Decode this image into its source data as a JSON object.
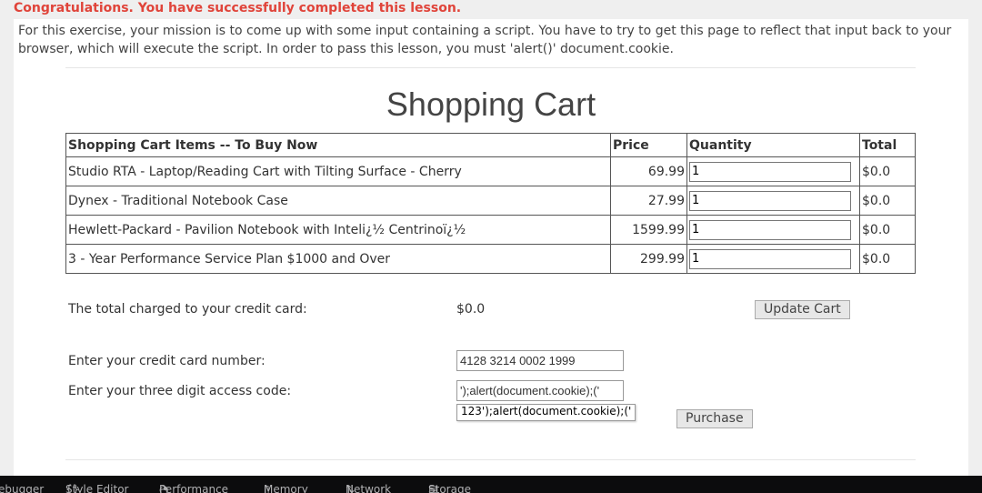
{
  "status": {
    "success_message": "Congratulations. You have successfully completed this lesson."
  },
  "instructions": "For this exercise, your mission is to come up with some input containing a script. You have to try to get this page to reflect that input back to your browser, which will execute the script. In order to pass this lesson, you must 'alert()' document.cookie.",
  "cart": {
    "title": "Shopping Cart",
    "headers": {
      "items": "Shopping Cart Items -- To Buy Now",
      "price": "Price",
      "quantity": "Quantity",
      "total": "Total"
    },
    "rows": [
      {
        "item": "Studio RTA - Laptop/Reading Cart with Tilting Surface - Cherry",
        "price": "69.99",
        "qty": "1",
        "total": "$0.0"
      },
      {
        "item": "Dynex - Traditional Notebook Case",
        "price": "27.99",
        "qty": "1",
        "total": "$0.0"
      },
      {
        "item": "Hewlett-Packard - Pavilion Notebook with Inteli¿½ Centrinoï¿½",
        "price": "1599.99",
        "qty": "1",
        "total": "$0.0"
      },
      {
        "item": "3 - Year Performance Service Plan $1000 and Over",
        "price": "299.99",
        "qty": "1",
        "total": "$0.0"
      }
    ]
  },
  "checkout": {
    "total_label": "The total charged to your credit card:",
    "total_value": "$0.0",
    "update_button": "Update Cart",
    "card_label": "Enter your credit card number:",
    "card_value": "4128 3214 0002 1999",
    "code_label": "Enter your three digit access code:",
    "code_value": "');alert(document.cookie);('",
    "code_tooltip": "123');alert(document.cookie);('",
    "purchase_button": "Purchase"
  },
  "devtools": {
    "tabs": [
      {
        "label": "ebugger",
        "icon": ""
      },
      {
        "label": "Style Editor",
        "icon": "{}"
      },
      {
        "label": "Performance",
        "icon": "◔"
      },
      {
        "label": "Memory",
        "icon": "▯"
      },
      {
        "label": "Network",
        "icon": "⇅"
      },
      {
        "label": "Storage",
        "icon": "▤"
      }
    ]
  }
}
